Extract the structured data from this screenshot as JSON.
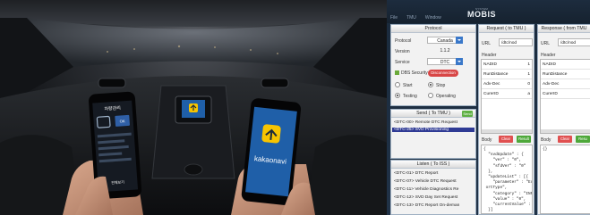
{
  "app": {
    "menu": [
      "File",
      "TMU",
      "Window"
    ],
    "logo": {
      "sub": "SYSTEM",
      "main": "MOBIS"
    },
    "protocol": {
      "title": "Protocol",
      "fields": [
        {
          "label": "Protocol",
          "value": "Canada"
        },
        {
          "label": "Version",
          "value": "1.1.2"
        },
        {
          "label": "Service",
          "value": "DTC"
        }
      ],
      "security_label": "DBS Security",
      "disconnect_label": "Disconnection",
      "radios": [
        "Start",
        "Stop",
        "Testing",
        "Operating"
      ]
    },
    "send": {
      "title": "Send ( To TMU )",
      "button": "Send",
      "items": [
        "<DTC-00> Remote DTC Request",
        "<DTC-25> SVD Provisioning"
      ]
    },
    "listen": {
      "title": "Listen ( To ISS )",
      "items": [
        "<DTC-01> DTC Report",
        "<DTC-07> Vehicle DTC Request",
        "<DTC-11> Vehicle Diagnostics Re",
        "<DTC-12> SVD Day Set Request",
        "<DTC-13> DTC Report On-deman"
      ]
    },
    "request": {
      "title": "Request ( to TMU )",
      "url_label": "URL",
      "url_value": "/dtc/nod",
      "header_label": "Header",
      "headers": [
        {
          "key": "NADID",
          "value": "1"
        },
        {
          "key": "RunDistance",
          "value": "1"
        },
        {
          "key": "Adv-Dec",
          "value": "0"
        },
        {
          "key": "CurerID",
          "value": "a"
        }
      ],
      "body_label": "Body",
      "clear_label": "Clear",
      "result_label": "Result",
      "body_text": "{\n  \"svdUpdate\" : {\n    \"ver\" : \"0\",\n    \"sfdVer\" : \"0\"\n  },\n  \"updateList\" : [{\n    \"parameter\" : \"EcuRep\n ortType\",\n    \"category\" : \"INFO\",\n    \"value\" : \"0\",\n    \"currentValue\" : \"0\"\n  }]\n}"
    },
    "response": {
      "title": "Response ( from TMU",
      "url_label": "URL",
      "url_value": "/dtc/nod",
      "header_label": "Header",
      "headers": [
        {
          "key": "NADID",
          "value": ""
        },
        {
          "key": "RunDistance",
          "value": ""
        },
        {
          "key": "Adv-Dec",
          "value": ""
        },
        {
          "key": "CurerID",
          "value": ""
        }
      ],
      "body_label": "Body",
      "clear_label": "Clear",
      "result_label": "Resu",
      "body_text": "{}"
    }
  },
  "photo": {
    "left_phone": {
      "title": "차량관리",
      "button": "OK",
      "bottom_text": "전체보기"
    },
    "right_phone": {
      "brand": "kakaonavi"
    }
  },
  "colors": {
    "accent_blue": "#3a78c9",
    "selected_row": "#2f3b95",
    "clear_red": "#e05050",
    "result_green": "#4ea83a",
    "kakao_yellow": "#f7c400"
  }
}
